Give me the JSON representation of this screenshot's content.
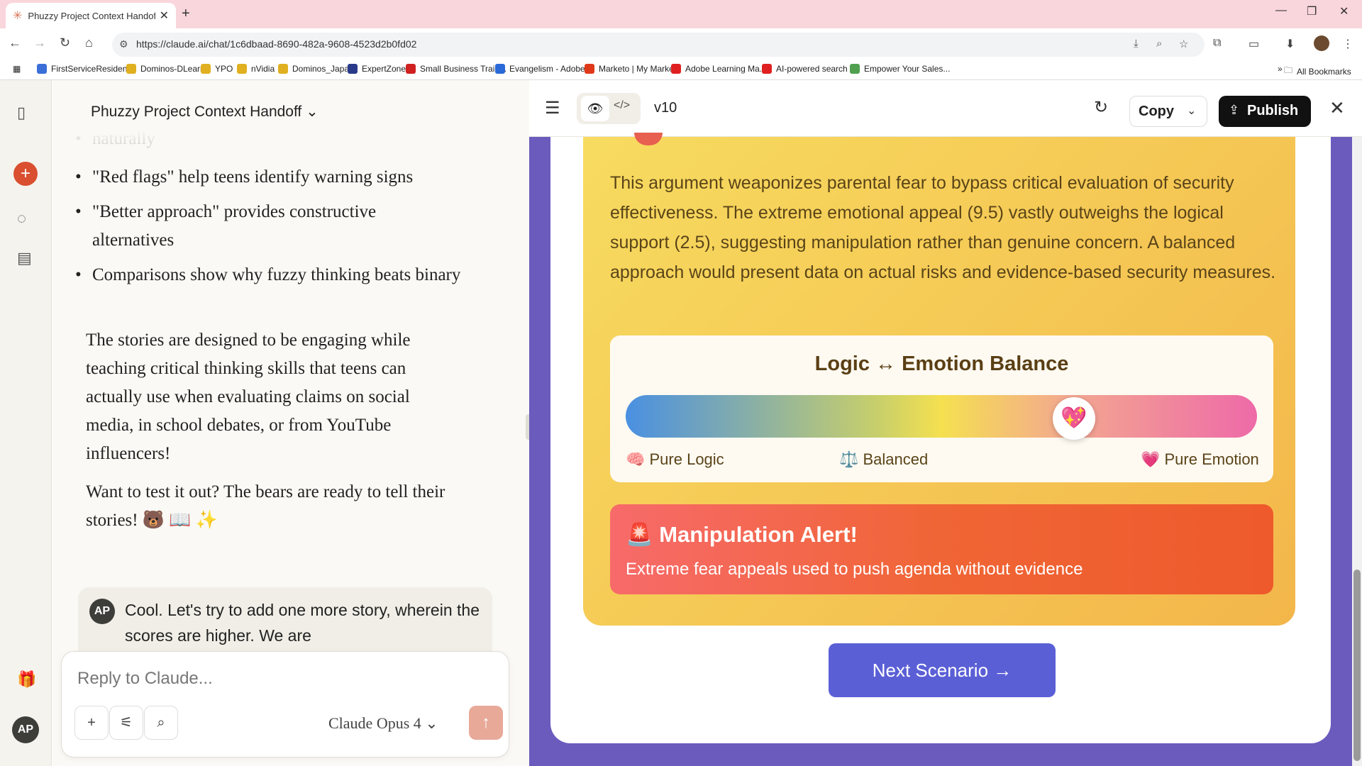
{
  "browser": {
    "tab_title": "Phuzzy Project Context Handoff",
    "url": "https://claude.ai/chat/1c6dbaad-8690-482a-9608-4523d2b0fd02",
    "bookmarks": [
      {
        "label": "FirstServiceResident...",
        "color": "#3a6fd8"
      },
      {
        "label": "Dominos-DLearn",
        "color": "#e0b020"
      },
      {
        "label": "YPO",
        "color": "#e0b020"
      },
      {
        "label": "nVidia",
        "color": "#e0b020"
      },
      {
        "label": "Dominos_Japan",
        "color": "#e0b020"
      },
      {
        "label": "ExpertZone",
        "color": "#2a3a8a"
      },
      {
        "label": "Small Business Train...",
        "color": "#d02020"
      },
      {
        "label": "Evangelism - Adobe...",
        "color": "#2a6ad8"
      },
      {
        "label": "Marketo | My Marke...",
        "color": "#e0391a"
      },
      {
        "label": "Adobe Learning Ma...",
        "color": "#e02020"
      },
      {
        "label": "AI-powered search i...",
        "color": "#e02020"
      },
      {
        "label": "Empower Your Sales...",
        "color": "#50a050"
      }
    ],
    "all_bookmarks": "All Bookmarks"
  },
  "chat": {
    "title": "Phuzzy Project Context Handoff",
    "faded_line": "naturally",
    "bullets": [
      "\"Red flags\" help teens identify warning signs",
      "\"Better approach\" provides constructive alternatives",
      "Comparisons show why fuzzy thinking beats binary"
    ],
    "paragraph1": "The stories are designed to be engaging while teaching critical thinking skills that teens can actually use when evaluating claims on social media, in school debates, or from YouTube influencers!",
    "paragraph2": "Want to test it out? The bears are ready to tell their stories! 🐻 📖 ✨",
    "user_initials": "AP",
    "user_message": "Cool. Let's try to add one more story, wherein the scores are higher.  We are",
    "placeholder": "Reply to Claude...",
    "model": "Claude Opus 4"
  },
  "artifact": {
    "version": "v10",
    "copy_label": "Copy",
    "publish_label": "Publish",
    "analysis": "This argument weaponizes parental fear to bypass critical evaluation of security effectiveness. The extreme emotional appeal (9.5) vastly outweighs the logical support (2.5), suggesting manipulation rather than genuine concern. A balanced approach would present data on actual risks and evidence-based security measures.",
    "balance_title": "Logic ↔ Emotion Balance",
    "balance_value": 0.71,
    "label_left": "🧠 Pure Logic",
    "label_mid": "⚖️ Balanced",
    "label_right": "💗 Pure Emotion",
    "knob_icon": "💖",
    "alert_title": "🚨 Manipulation Alert!",
    "alert_text": "Extreme fear appeals used to push agenda without evidence",
    "next_button": "Next Scenario →"
  },
  "user_initials": "AP"
}
